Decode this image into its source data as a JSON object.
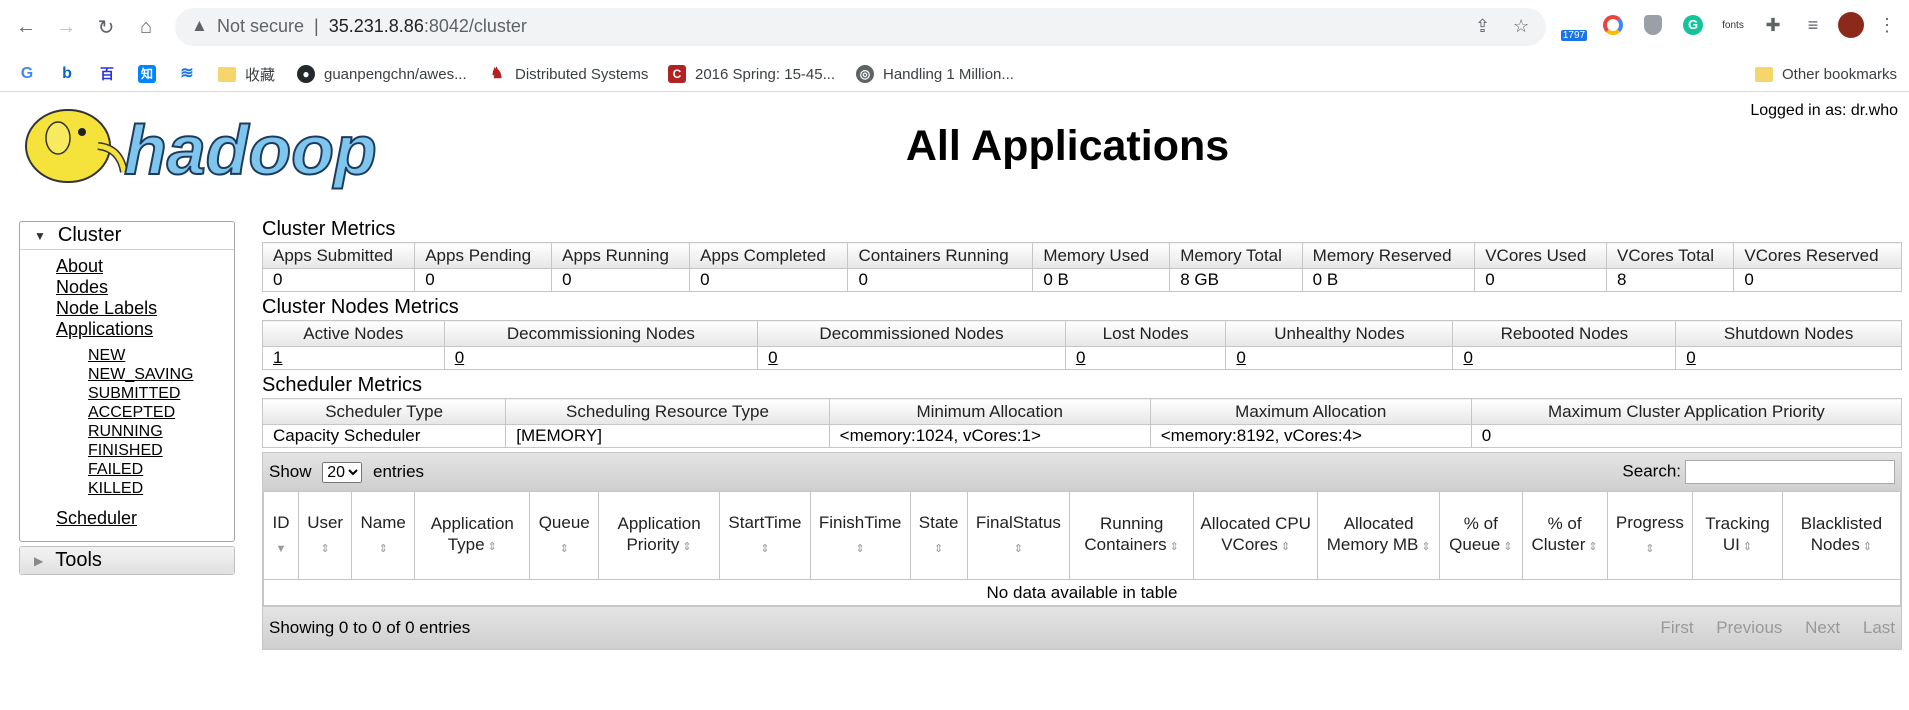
{
  "browser": {
    "url_warning": "Not secure",
    "url_host": "35.231.8.86",
    "url_rest": ":8042/cluster",
    "extension_badge": "1797",
    "ext_fonts": "fonts",
    "bookmarks": [
      {
        "label": "收藏",
        "icon": "folder-icon"
      },
      {
        "label": "guanpengchn/awes...",
        "icon": "github-icon"
      },
      {
        "label": "Distributed Systems",
        "icon": "site-icon"
      },
      {
        "label": "2016 Spring: 15-45...",
        "icon": "c-icon"
      },
      {
        "label": "Handling 1 Million...",
        "icon": "globe-icon"
      }
    ],
    "bookmark_icons": [
      "G",
      "b",
      "百",
      "知",
      "≋"
    ],
    "other_bookmarks": "Other bookmarks"
  },
  "header": {
    "logo_text": "hadoop",
    "title": "All Applications",
    "logged_in": "Logged in as: dr.who"
  },
  "sidebar": {
    "cluster_label": "Cluster",
    "links": [
      "About",
      "Nodes",
      "Node Labels",
      "Applications"
    ],
    "app_states": [
      "NEW",
      "NEW_SAVING",
      "SUBMITTED",
      "ACCEPTED",
      "RUNNING",
      "FINISHED",
      "FAILED",
      "KILLED"
    ],
    "scheduler": "Scheduler",
    "tools_label": "Tools"
  },
  "cluster_metrics": {
    "title": "Cluster Metrics",
    "headers": [
      "Apps Submitted",
      "Apps Pending",
      "Apps Running",
      "Apps Completed",
      "Containers Running",
      "Memory Used",
      "Memory Total",
      "Memory Reserved",
      "VCores Used",
      "VCores Total",
      "VCores Reserved"
    ],
    "values": [
      "0",
      "0",
      "0",
      "0",
      "0",
      "0 B",
      "8 GB",
      "0 B",
      "0",
      "8",
      "0"
    ]
  },
  "node_metrics": {
    "title": "Cluster Nodes Metrics",
    "headers": [
      "Active Nodes",
      "Decommissioning Nodes",
      "Decommissioned Nodes",
      "Lost Nodes",
      "Unhealthy Nodes",
      "Rebooted Nodes",
      "Shutdown Nodes"
    ],
    "values": [
      "1",
      "0",
      "0",
      "0",
      "0",
      "0",
      "0"
    ]
  },
  "scheduler_metrics": {
    "title": "Scheduler Metrics",
    "headers": [
      "Scheduler Type",
      "Scheduling Resource Type",
      "Minimum Allocation",
      "Maximum Allocation",
      "Maximum Cluster Application Priority"
    ],
    "values": [
      "Capacity Scheduler",
      "[MEMORY]",
      "<memory:1024, vCores:1>",
      "<memory:8192, vCores:4>",
      "0"
    ]
  },
  "apps_table": {
    "show": "Show",
    "entries_value": "20",
    "entries": "entries",
    "search_label": "Search:",
    "columns": [
      "ID",
      "User",
      "Name",
      "Application Type",
      "Queue",
      "Application Priority",
      "StartTime",
      "FinishTime",
      "State",
      "FinalStatus",
      "Running Containers",
      "Allocated CPU VCores",
      "Allocated Memory MB",
      "% of Queue",
      "% of Cluster",
      "Progress",
      "Tracking UI",
      "Blacklisted Nodes"
    ],
    "empty": "No data available in table",
    "info": "Showing 0 to 0 of 0 entries",
    "pager": [
      "First",
      "Previous",
      "Next",
      "Last"
    ]
  }
}
